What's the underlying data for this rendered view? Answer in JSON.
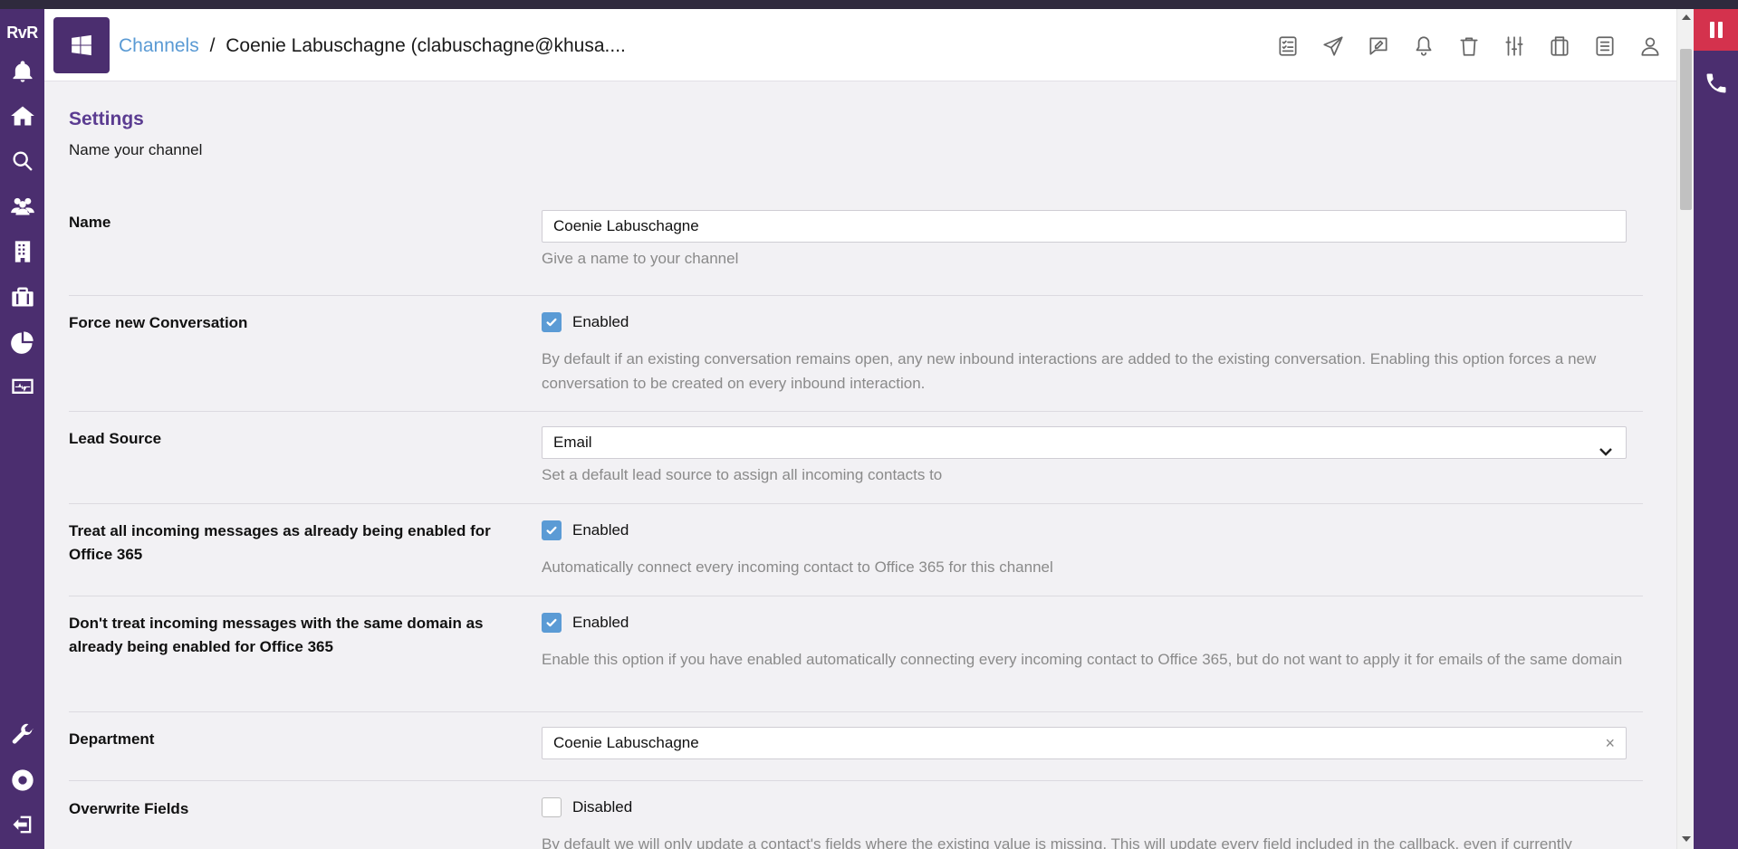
{
  "brand": {
    "logo_text": "RvR"
  },
  "sidebar": {
    "items": [
      {
        "name": "notifications",
        "icon": "bell-icon"
      },
      {
        "name": "home",
        "icon": "home-icon"
      },
      {
        "name": "search",
        "icon": "search-icon"
      },
      {
        "name": "contacts",
        "icon": "users-icon"
      },
      {
        "name": "companies",
        "icon": "building-icon"
      },
      {
        "name": "deals",
        "icon": "briefcase-icon"
      },
      {
        "name": "reports",
        "icon": "pie-chart-icon"
      },
      {
        "name": "monitor",
        "icon": "monitor-icon"
      }
    ],
    "bottom_items": [
      {
        "name": "tools",
        "icon": "wrench-icon"
      },
      {
        "name": "help",
        "icon": "lifebuoy-icon"
      },
      {
        "name": "logout",
        "icon": "sign-out-icon"
      }
    ]
  },
  "header": {
    "breadcrumb_link": "Channels",
    "breadcrumb_sep": "/",
    "breadcrumb_current": "Coenie Labuschagne (clabuschagne@khusa....",
    "toolbar_icons": [
      "checklist-icon",
      "send-icon",
      "edit-note-icon",
      "bell-icon",
      "trash-icon",
      "sliders-icon",
      "copy-icon",
      "list-icon",
      "user-icon"
    ]
  },
  "settings": {
    "title": "Settings",
    "subtitle": "Name your channel",
    "name": {
      "label": "Name",
      "value": "Coenie Labuschagne",
      "help": "Give a name to your channel"
    },
    "force_new": {
      "label": "Force new Conversation",
      "checked": true,
      "state": "Enabled",
      "help": "By default if an existing conversation remains open, any new inbound interactions are added to the existing conversation. Enabling this option forces a new conversation to be created on every inbound interaction."
    },
    "lead_source": {
      "label": "Lead Source",
      "value": "Email",
      "help": "Set a default lead source to assign all incoming contacts to"
    },
    "treat_incoming": {
      "label": "Treat all incoming messages as already being enabled for Office 365",
      "checked": true,
      "state": "Enabled",
      "help": "Automatically connect every incoming contact to Office 365 for this channel"
    },
    "same_domain": {
      "label": "Don't treat incoming messages with the same domain as already being enabled for Office 365",
      "checked": true,
      "state": "Enabled",
      "help": "Enable this option if you have enabled automatically connecting every incoming contact to Office 365, but do not want to apply it for emails of the same domain"
    },
    "department": {
      "label": "Department",
      "value": "Coenie Labuschagne",
      "clear": "×"
    },
    "overwrite": {
      "label": "Overwrite Fields",
      "checked": false,
      "state": "Disabled",
      "help": "By default we will only update a contact's fields where the existing value is missing. This will update every field included in the callback, even if currently"
    }
  },
  "colors": {
    "sidebar": "#4b2e6f",
    "accent": "#5b3c91",
    "link": "#5a9ad4",
    "pause": "#d4324d",
    "checkbox": "#5b9bd5"
  }
}
